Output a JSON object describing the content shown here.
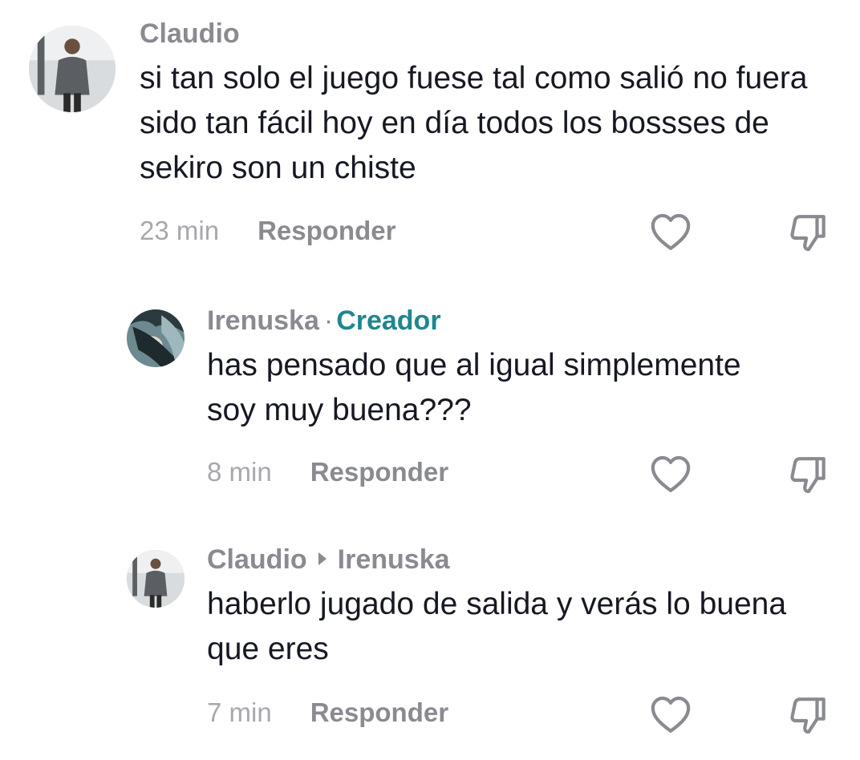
{
  "comments": [
    {
      "author": "Claudio",
      "text": "si tan solo el juego fuese tal como salió no fuera sido tan fácil hoy en día todos los bossses de sekiro son un chiste",
      "time": "23 min",
      "reply_label": "Responder"
    },
    {
      "author": "Irenuska",
      "separator": "·",
      "creator_badge": "Creador",
      "text": "has pensado que al igual simplemente soy muy buena???",
      "time": "8 min",
      "reply_label": "Responder"
    },
    {
      "author": "Claudio",
      "reply_to": "Irenuska",
      "text": "haberlo jugado de salida y verás lo buena que eres",
      "time": "7 min",
      "reply_label": "Responder"
    }
  ],
  "icons": {
    "like": "heart-icon",
    "dislike": "thumbs-down-icon",
    "reply_arrow": "play-arrow-icon"
  },
  "colors": {
    "creator": "#20868e",
    "muted": "#8a8b91",
    "time": "#a7a8ad",
    "text": "#161823"
  }
}
